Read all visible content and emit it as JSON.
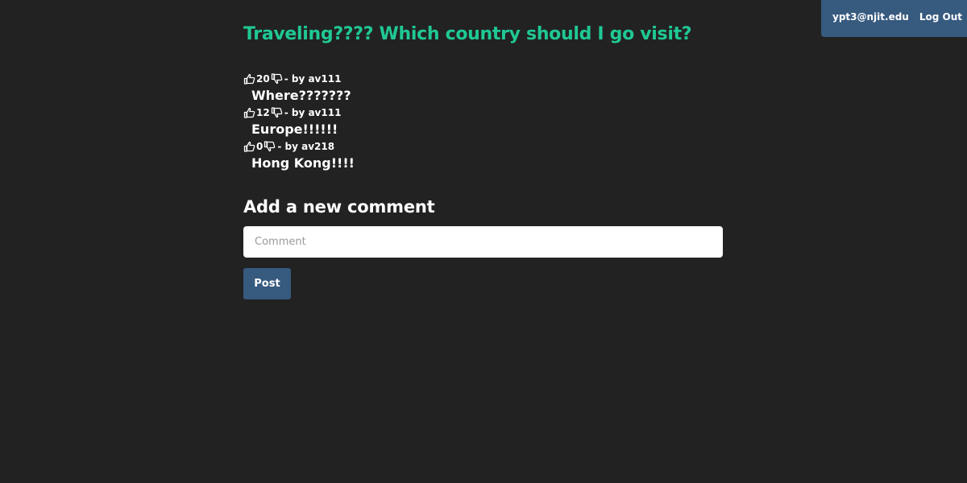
{
  "navbar": {
    "user_email": "ypt3@njit.edu",
    "logout_label": "Log Out"
  },
  "post": {
    "title": "Traveling???? Which country should I go visit?"
  },
  "comments": [
    {
      "votes": "20",
      "author": "- by av111",
      "text": "Where???????"
    },
    {
      "votes": "12",
      "author": "- by av111",
      "text": "Europe!!!!!!"
    },
    {
      "votes": "0",
      "author": "- by av218",
      "text": "Hong Kong!!!!"
    }
  ],
  "new_comment": {
    "heading": "Add a new comment",
    "placeholder": "Comment",
    "value": "",
    "submit_label": "Post"
  },
  "colors": {
    "background": "#222222",
    "accent": "#1fc894",
    "primary": "#375a7f"
  },
  "icons": {
    "upvote": "thumbs-up-icon",
    "downvote": "thumbs-down-icon"
  }
}
